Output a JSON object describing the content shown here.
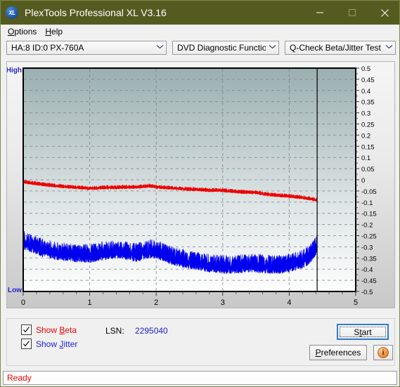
{
  "window": {
    "title": "PlexTools Professional XL V3.16",
    "icon": "xl-app-icon",
    "icon_text": "XL",
    "titlebar_color": "#555b20",
    "minimize_label": "Minimize",
    "maximize_label": "Maximize",
    "close_label": "Close"
  },
  "menu": {
    "items": [
      {
        "label": "Options",
        "accel": "O"
      },
      {
        "label": "Help",
        "accel": "H"
      }
    ]
  },
  "toolbar": {
    "drive_select": {
      "value": "HA:8 ID:0  PX-760A"
    },
    "function_select": {
      "value": "DVD Diagnostic Functions"
    },
    "test_select": {
      "value": "Q-Check Beta/Jitter Test"
    },
    "dropdown_arrow": "⌄"
  },
  "controls": {
    "show_beta": {
      "label_pre": "Show ",
      "label_accel": "B",
      "label_post": "eta",
      "checked": true,
      "color": "#ee0000"
    },
    "show_jitter": {
      "label_pre": "Show ",
      "label_accel": "J",
      "label_post": "itter",
      "checked": true,
      "color": "#2222dd"
    },
    "lsn_label": "LSN:",
    "lsn_value": "2295040",
    "start_button": {
      "label_pre": "S",
      "label_accel": "t",
      "label_post": "art",
      "focused": true
    },
    "preferences_button": {
      "label_pre": "",
      "label_accel": "P",
      "label_post": "references"
    },
    "info_button": {
      "glyph": "i",
      "tooltip": "Info"
    }
  },
  "status": {
    "text": "Ready"
  },
  "chart_data": {
    "type": "line",
    "title": "",
    "xlabel": "",
    "ylabel": "",
    "xlim": [
      0,
      5
    ],
    "ylim": [
      -0.5,
      0.5
    ],
    "x_ticks": [
      "0",
      "1",
      "2",
      "3",
      "4",
      "5"
    ],
    "x_tick_values": [
      0,
      1,
      2,
      3,
      4,
      5
    ],
    "y_ticks": [
      "0.5",
      "0.45",
      "0.4",
      "0.35",
      "0.3",
      "0.25",
      "0.2",
      "0.15",
      "0.1",
      "0.05",
      "0",
      "-0.05",
      "-0.1",
      "-0.15",
      "-0.2",
      "-0.25",
      "-0.3",
      "-0.35",
      "-0.4",
      "-0.45",
      "-0.5"
    ],
    "y_tick_values": [
      0.5,
      0.45,
      0.4,
      0.35,
      0.3,
      0.25,
      0.2,
      0.15,
      0.1,
      0.05,
      0,
      -0.05,
      -0.1,
      -0.15,
      -0.2,
      -0.25,
      -0.3,
      -0.35,
      -0.4,
      -0.45,
      -0.5
    ],
    "axis_high_label": "High",
    "axis_low_label": "Low",
    "grid": true,
    "grid_style": "dashed",
    "grid_color": "#808080",
    "plot_bg_top_color": "#9aafb0",
    "plot_bg_bottom_color": "#fdfdfd",
    "data_end_marker_x": 4.42,
    "series": [
      {
        "name": "Beta",
        "color": "#ee0000",
        "noise": 0.006,
        "x": [
          0.0,
          0.1,
          0.2,
          0.3,
          0.4,
          0.5,
          0.6,
          0.7,
          0.8,
          0.9,
          1.0,
          1.1,
          1.2,
          1.3,
          1.4,
          1.5,
          1.6,
          1.7,
          1.8,
          1.9,
          2.0,
          2.1,
          2.2,
          2.3,
          2.4,
          2.5,
          2.6,
          2.7,
          2.8,
          2.9,
          3.0,
          3.1,
          3.2,
          3.3,
          3.4,
          3.5,
          3.6,
          3.7,
          3.8,
          3.9,
          4.0,
          4.1,
          4.2,
          4.3,
          4.42
        ],
        "values": [
          -0.008,
          -0.012,
          -0.016,
          -0.02,
          -0.023,
          -0.026,
          -0.029,
          -0.031,
          -0.033,
          -0.035,
          -0.037,
          -0.036,
          -0.034,
          -0.033,
          -0.033,
          -0.032,
          -0.032,
          -0.031,
          -0.029,
          -0.026,
          -0.031,
          -0.033,
          -0.035,
          -0.037,
          -0.039,
          -0.041,
          -0.042,
          -0.044,
          -0.046,
          -0.045,
          -0.047,
          -0.049,
          -0.052,
          -0.054,
          -0.055,
          -0.056,
          -0.061,
          -0.065,
          -0.068,
          -0.07,
          -0.072,
          -0.075,
          -0.078,
          -0.083,
          -0.09
        ]
      },
      {
        "name": "Jitter",
        "color": "#0000ee",
        "noise": 0.03,
        "x": [
          0.0,
          0.1,
          0.2,
          0.3,
          0.4,
          0.5,
          0.6,
          0.7,
          0.8,
          0.9,
          1.0,
          1.1,
          1.2,
          1.3,
          1.4,
          1.5,
          1.6,
          1.7,
          1.8,
          1.9,
          2.0,
          2.1,
          2.2,
          2.3,
          2.4,
          2.5,
          2.6,
          2.7,
          2.8,
          2.9,
          3.0,
          3.1,
          3.2,
          3.3,
          3.4,
          3.5,
          3.6,
          3.7,
          3.8,
          3.9,
          4.0,
          4.1,
          4.2,
          4.3,
          4.38,
          4.42
        ],
        "values": [
          -0.27,
          -0.28,
          -0.293,
          -0.305,
          -0.312,
          -0.318,
          -0.322,
          -0.325,
          -0.327,
          -0.328,
          -0.33,
          -0.325,
          -0.318,
          -0.313,
          -0.312,
          -0.315,
          -0.32,
          -0.325,
          -0.318,
          -0.308,
          -0.312,
          -0.322,
          -0.335,
          -0.345,
          -0.352,
          -0.358,
          -0.362,
          -0.368,
          -0.372,
          -0.375,
          -0.378,
          -0.38,
          -0.378,
          -0.375,
          -0.372,
          -0.374,
          -0.376,
          -0.378,
          -0.38,
          -0.378,
          -0.372,
          -0.365,
          -0.355,
          -0.338,
          -0.305,
          -0.285
        ]
      }
    ]
  }
}
